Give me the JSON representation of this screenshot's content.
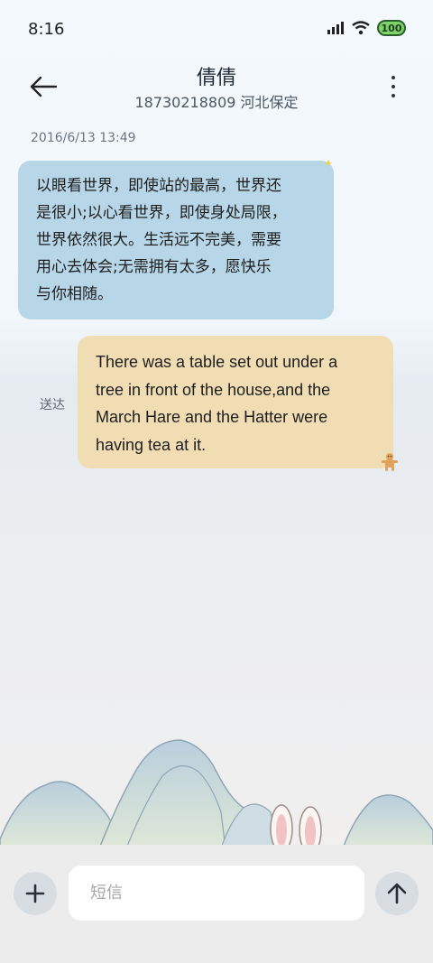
{
  "status": {
    "time": "8:16",
    "battery": "100"
  },
  "header": {
    "name": "倩倩",
    "subtitle": "18730218809 河北保定"
  },
  "messages": {
    "timestamp": "2016/6/13 13:49",
    "incoming": [
      "以眼看世界，即使站的最高，世界还",
      "是很小;以心看世界，即使身处局限，",
      "世界依然很大。生活远不完美，需要",
      "用心去体会;无需拥有太多，愿快乐",
      "与你相随。"
    ],
    "outgoing": [
      "There was a table set out under a",
      "tree in front of the house,and the",
      "March Hare and the Hatter were",
      "having tea at it."
    ],
    "delivered_label": "送达"
  },
  "composer": {
    "placeholder": "短信"
  },
  "icons": {
    "back": "arrow-left-icon",
    "more": "more-vertical-icon",
    "add": "plus-icon",
    "send": "arrow-up-icon",
    "signal": "signal-icon",
    "wifi": "wifi-icon",
    "battery": "battery-icon"
  },
  "colors": {
    "incoming_bubble": "#b7d6e8",
    "outgoing_bubble": "#f0ddb3"
  }
}
